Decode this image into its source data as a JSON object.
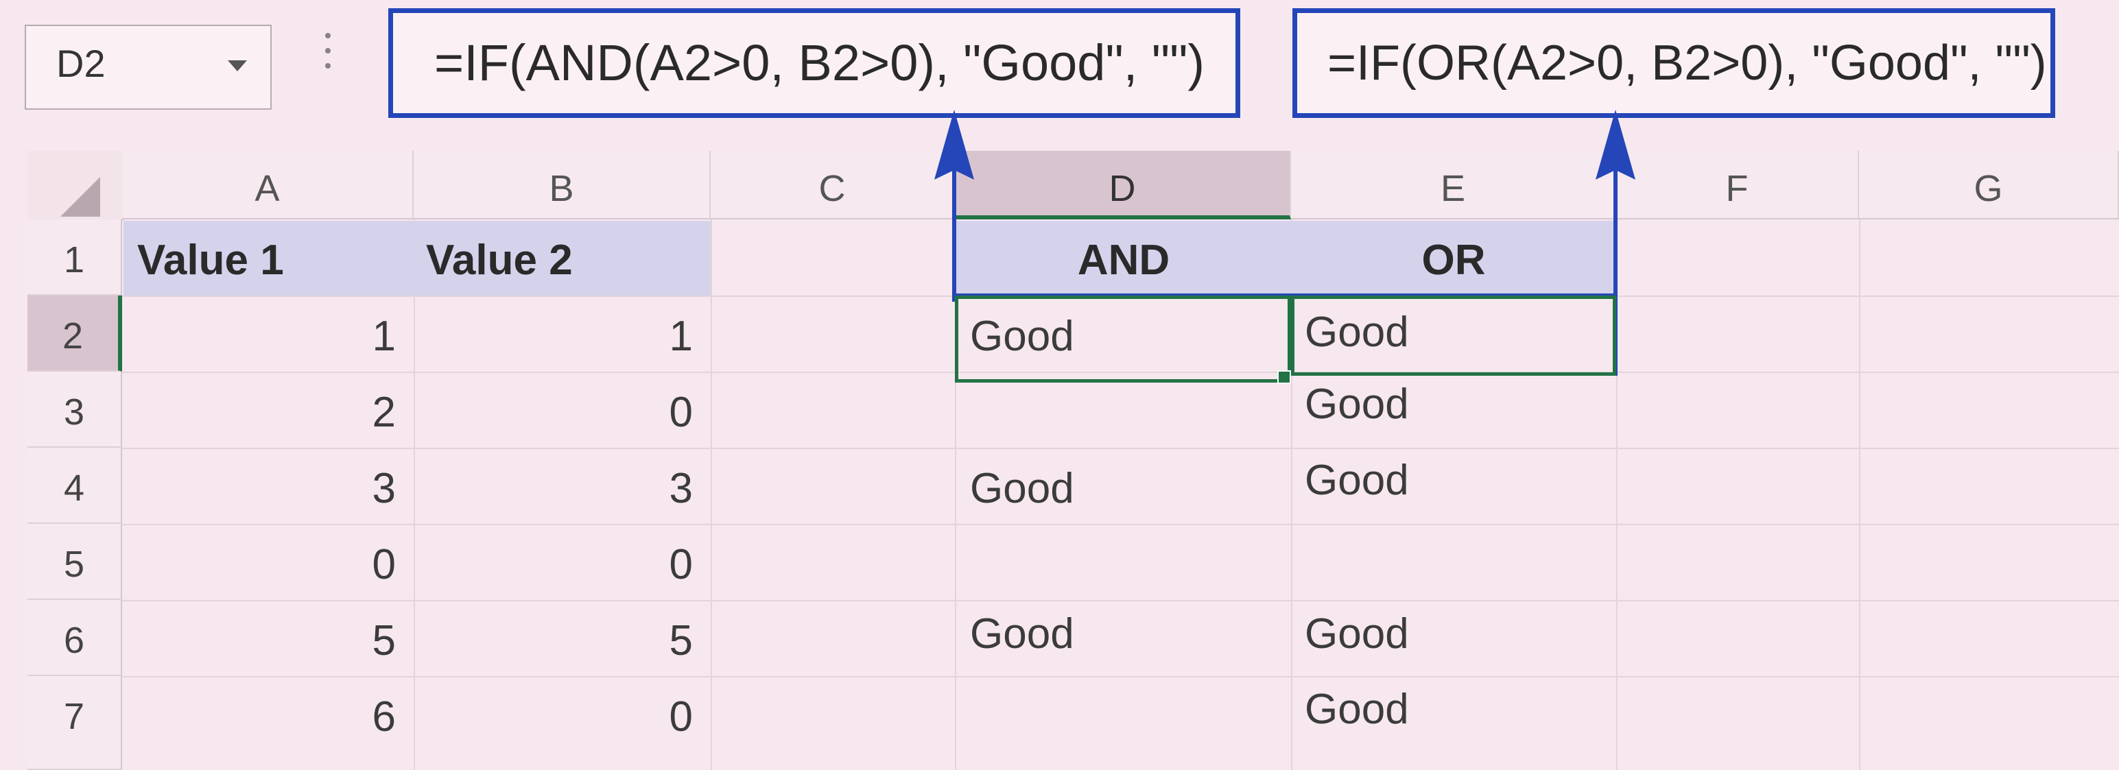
{
  "name_box": {
    "value": "D2"
  },
  "formula_bar": {
    "and_formula": "=IF(AND(A2>0, B2>0), \"Good\", \"\")",
    "or_formula": "=IF(OR(A2>0, B2>0), \"Good\", \"\")"
  },
  "sheet": {
    "columns": [
      "A",
      "B",
      "C",
      "D",
      "E",
      "F",
      "G"
    ],
    "rows": [
      "1",
      "2",
      "3",
      "4",
      "5",
      "6",
      "7"
    ],
    "selected_cell": "D2",
    "headers": {
      "a1": "Value 1",
      "b1": "Value 2",
      "d1": "AND",
      "e1": "OR"
    },
    "data": [
      {
        "a": "1",
        "b": "1",
        "d": "Good",
        "e": "Good"
      },
      {
        "a": "2",
        "b": "0",
        "d": "",
        "e": "Good"
      },
      {
        "a": "3",
        "b": "3",
        "d": "Good",
        "e": "Good"
      },
      {
        "a": "0",
        "b": "0",
        "d": "",
        "e": ""
      },
      {
        "a": "5",
        "b": "5",
        "d": "Good",
        "e": "Good"
      },
      {
        "a": "6",
        "b": "0",
        "d": "",
        "e": "Good"
      }
    ]
  },
  "colors": {
    "selection_green": "#217346",
    "annotation_blue": "#2446b8",
    "header_fill": "#d5d3ec"
  }
}
